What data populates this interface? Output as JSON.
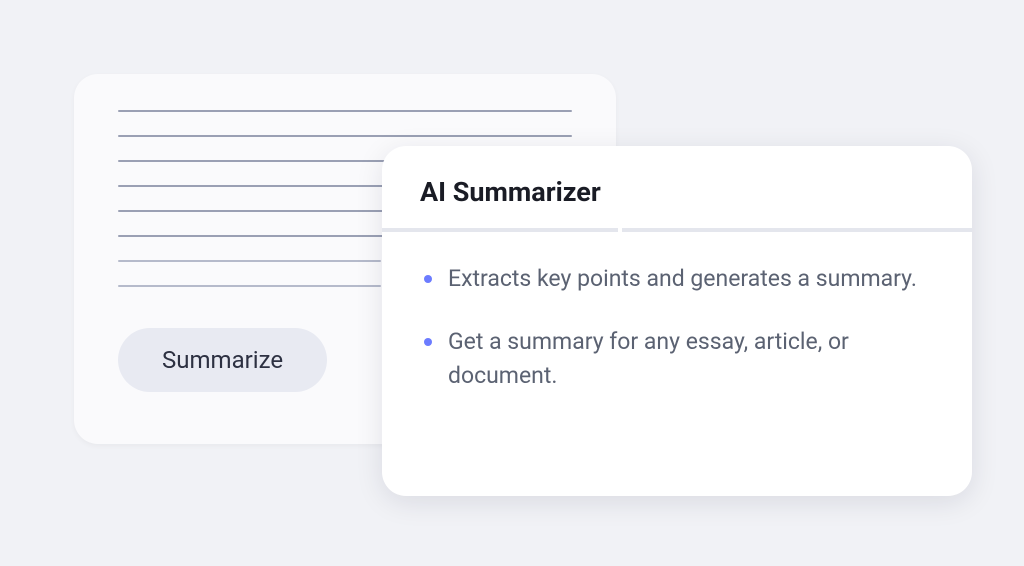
{
  "input_card": {
    "summarize_button_label": "Summarize"
  },
  "info_card": {
    "title": "AI Summarizer",
    "features": [
      "Extracts key points and generates a summary.",
      "Get a summary for any essay, article, or document."
    ]
  }
}
